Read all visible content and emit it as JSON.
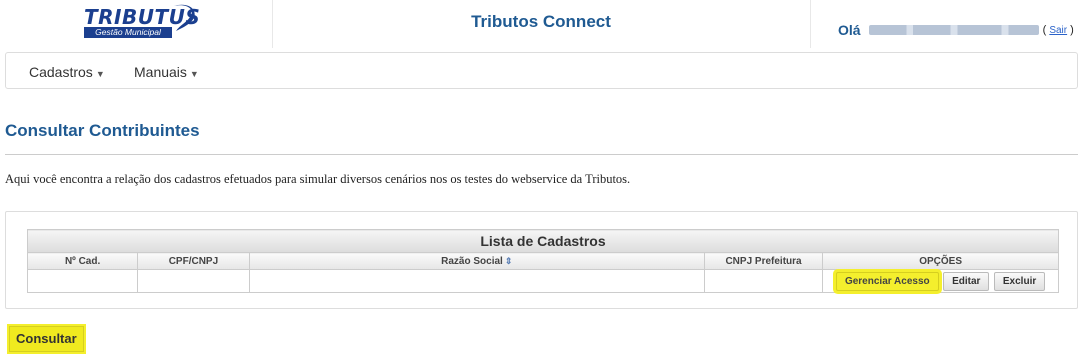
{
  "header": {
    "logo": {
      "main": "TRIBUTUS",
      "sub": "Gestão Municipal"
    },
    "app_title": "Tributos Connect",
    "greeting": "Olá",
    "logout_open": "(",
    "logout_label": "Sair",
    "logout_close": ")"
  },
  "nav": {
    "items": [
      {
        "label": "Cadastros"
      },
      {
        "label": "Manuais"
      }
    ]
  },
  "page": {
    "title": "Consultar Contribuintes",
    "description": "Aqui você encontra a relação dos cadastros efetuados para simular diversos cenários nos os testes do webservice da Tributos."
  },
  "table": {
    "caption": "Lista de Cadastros",
    "columns": [
      "Nº Cad.",
      "CPF/CNPJ",
      "Razão Social",
      "CNPJ Prefeitura",
      "OPÇÕES"
    ],
    "row_actions": [
      "Gerenciar Acesso",
      "Editar",
      "Excluir"
    ]
  },
  "actions": {
    "consultar_label": "Consultar"
  },
  "colors": {
    "brand_blue": "#1f5a92",
    "highlight": "#f4ef2d"
  }
}
